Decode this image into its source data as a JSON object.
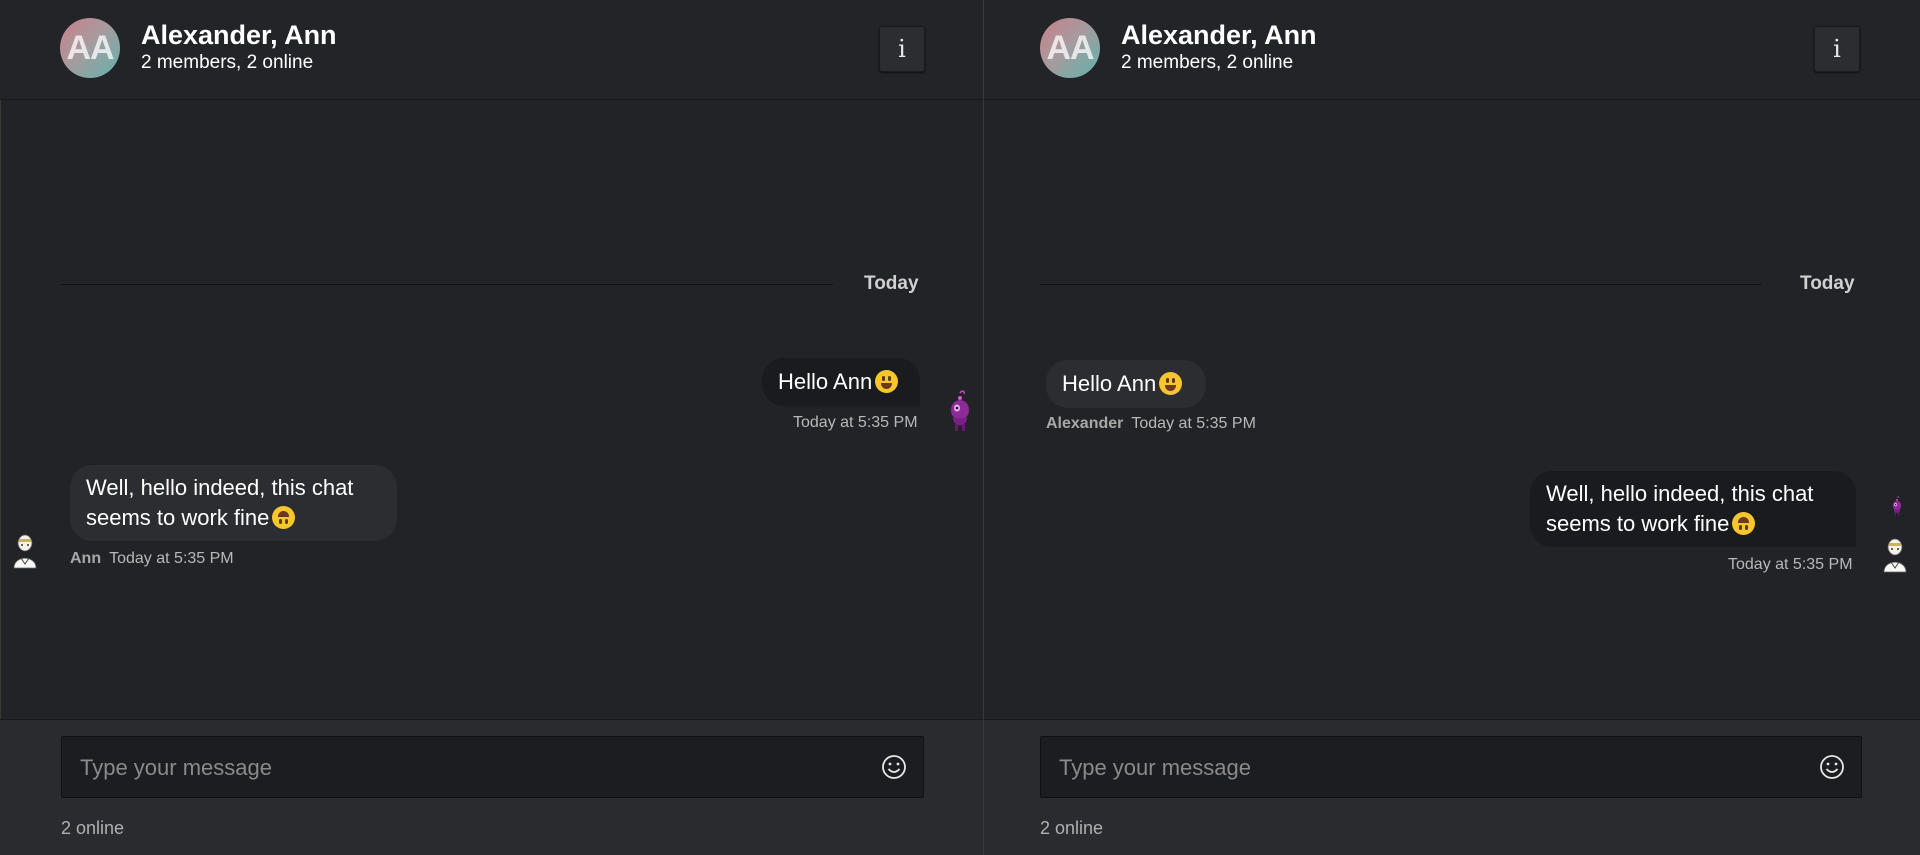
{
  "panes": [
    {
      "header": {
        "initials": "AA",
        "title": "Alexander, Ann",
        "subtitle": "2 members, 2 online",
        "info_label": "i"
      },
      "date_divider": "Today",
      "messages": [
        {
          "text": "Hello Ann",
          "emoji": "grinning-face",
          "time": "Today at 5:35 PM"
        },
        {
          "sender": "Ann",
          "text1": "Well, hello indeed, this chat",
          "text2": "seems to work fine",
          "emoji": "upside-down-face",
          "time": "Today at 5:35 PM"
        }
      ],
      "composer": {
        "placeholder": "Type your message",
        "emoji_icon": "smiley-icon"
      },
      "status": "2 online"
    },
    {
      "header": {
        "initials": "AA",
        "title": "Alexander, Ann",
        "subtitle": "2 members, 2 online",
        "info_label": "i"
      },
      "date_divider": "Today",
      "messages": [
        {
          "sender": "Alexander",
          "text": "Hello Ann",
          "emoji": "grinning-face",
          "time": "Today at 5:35 PM"
        },
        {
          "text1": "Well, hello indeed, this chat",
          "text2": "seems to work fine",
          "emoji": "upside-down-face",
          "time": "Today at 5:35 PM"
        }
      ],
      "composer": {
        "placeholder": "Type your message",
        "emoji_icon": "smiley-icon"
      },
      "status": "2 online"
    }
  ],
  "colors": {
    "background": "#222327",
    "bubble_dark": "#1a1b1e",
    "bubble_light": "#2c2d31",
    "emoji": "#f7c52e",
    "avatar_purple": "#8e2a9a"
  }
}
